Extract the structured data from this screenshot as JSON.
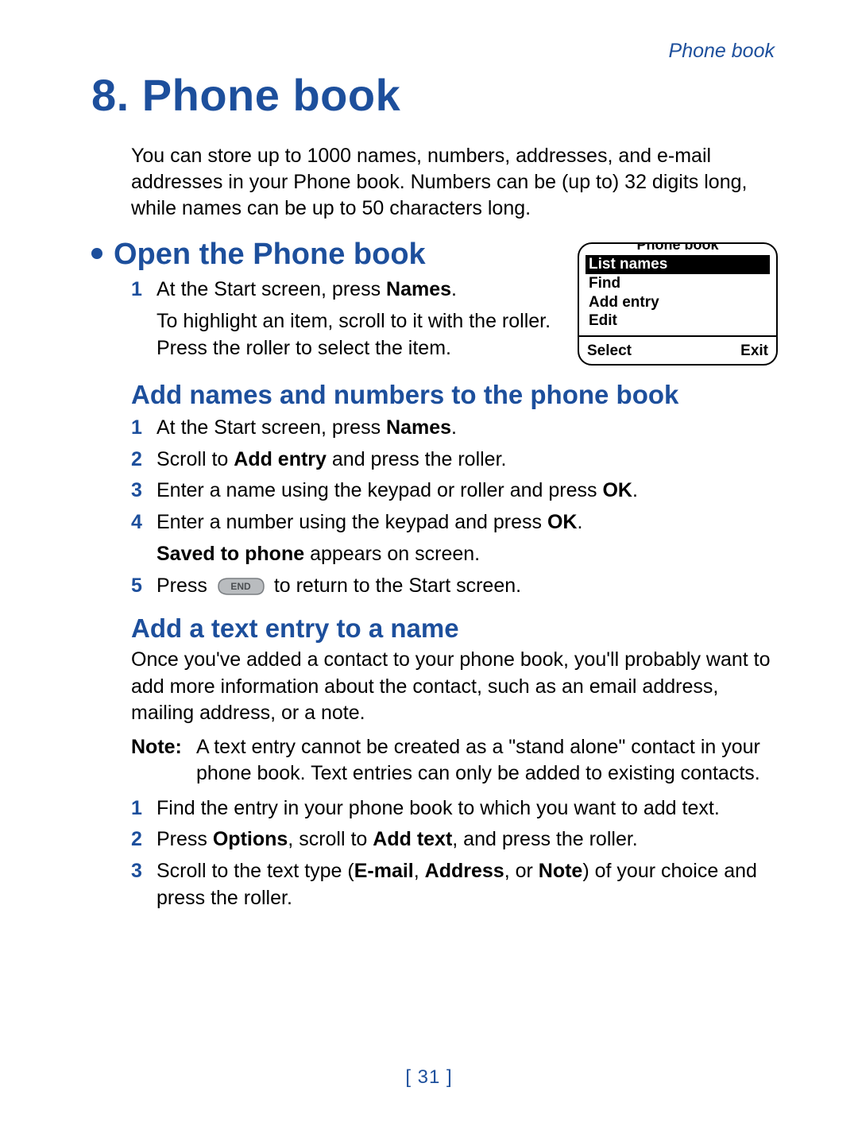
{
  "running_head": "Phone book",
  "chapter": {
    "number": "8.",
    "title": "Phone book"
  },
  "intro": "You can store up to 1000 names, numbers, addresses, and e-mail addresses in your Phone book. Numbers can be (up to) 32 digits long, while names can be up to 50 characters long.",
  "open_section": {
    "heading": "Open the Phone book",
    "step1_pre": "At the Start screen, press ",
    "step1_bold": "Names",
    "step1_post": ".",
    "sub1": "To highlight an item, scroll to it with the roller. Press the roller to select the item."
  },
  "phone_screen": {
    "title": "Phone book",
    "items": [
      "List names",
      "Find",
      "Add entry",
      "Edit"
    ],
    "selected_index": 0,
    "softkeys": {
      "left": "Select",
      "right": "Exit"
    }
  },
  "add_names_section": {
    "heading": "Add names and numbers to the phone book",
    "steps": [
      {
        "n": "1",
        "pre": "At the Start screen, press ",
        "b1": "Names",
        "post": "."
      },
      {
        "n": "2",
        "pre": "Scroll to ",
        "b1": "Add entry",
        "post": " and press the roller."
      },
      {
        "n": "3",
        "pre": "Enter a name using the keypad or roller and press ",
        "b1": "OK",
        "post": "."
      },
      {
        "n": "4",
        "pre": "Enter a number using the keypad and press ",
        "b1": "OK",
        "post": "."
      }
    ],
    "saved_line_b": "Saved to phone",
    "saved_line_post": " appears on screen.",
    "step5_n": "5",
    "step5_pre": "Press ",
    "step5_post": " to return to the Start screen.",
    "end_key_label": "END"
  },
  "add_text_section": {
    "heading": "Add a text entry to a name",
    "intro": "Once you've added a contact to your phone book, you'll probably want to add more information about the contact, such as an email address, mailing address, or a note.",
    "note_label": "Note:",
    "note_text": "A text entry cannot be created as a \"stand alone\" contact in your phone book. Text entries can only be added to existing contacts.",
    "steps": {
      "s1": {
        "n": "1",
        "text": "Find the entry in your phone book to which you want to add text."
      },
      "s2": {
        "n": "2",
        "pre": "Press ",
        "b1": "Options",
        "mid": ", scroll to ",
        "b2": "Add text",
        "post": ", and press the roller."
      },
      "s3": {
        "n": "3",
        "pre": "Scroll to the text type (",
        "b1": "E-mail",
        "c1": ", ",
        "b2": "Address",
        "c2": ", or ",
        "b3": "Note",
        "post": ") of your choice and press the roller."
      }
    }
  },
  "page_number": "[ 31 ]"
}
